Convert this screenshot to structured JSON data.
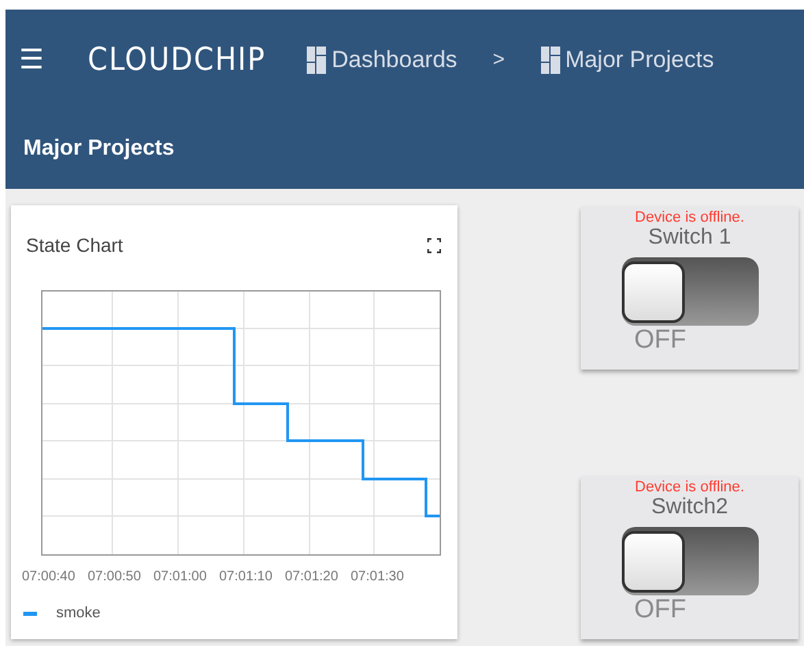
{
  "header": {
    "menu_icon": "☰",
    "logo": "CLOUDCHIP",
    "breadcrumbs": [
      {
        "label": "Dashboards"
      },
      {
        "label": "Major Projects"
      }
    ],
    "separator": ">",
    "page_title": "Major Projects"
  },
  "chart_card": {
    "title": "State Chart",
    "x_ticks": [
      "07:00:40",
      "07:00:50",
      "07:01:00",
      "07:01:10",
      "07:01:20",
      "07:01:30"
    ],
    "legend": [
      {
        "name": "smoke",
        "color": "#2196f3"
      }
    ]
  },
  "switches": [
    {
      "status": "Device is offline.",
      "title": "Switch 1",
      "on": false,
      "state_label": "OFF"
    },
    {
      "status": "Device is offline.",
      "title": "Switch2",
      "on": false,
      "state_label": "OFF"
    }
  ]
}
